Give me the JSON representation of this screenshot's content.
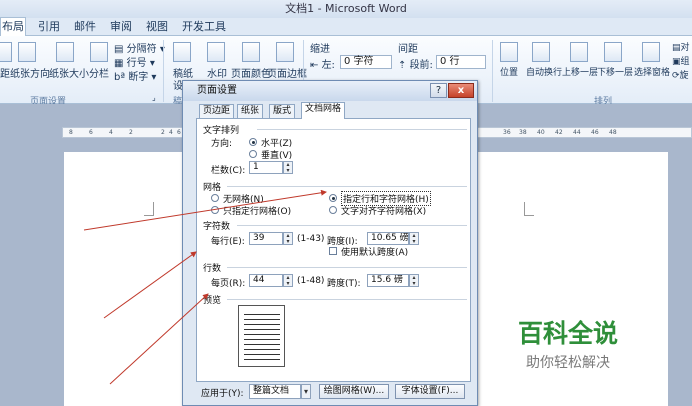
{
  "window": {
    "title": "文档1 - Microsoft Word"
  },
  "tabs": {
    "active": "布局",
    "items": [
      "引用",
      "邮件",
      "审阅",
      "视图",
      "开发工具"
    ]
  },
  "ribbon": {
    "page_setup": {
      "margins": "距",
      "orientation": "纸张方向",
      "size": "纸张大小",
      "columns": "分栏",
      "breaks": "分隔符",
      "line_numbers": "行号",
      "hyphenation": "断字",
      "group": "页面设置"
    },
    "manuscript": {
      "label1": "稿纸",
      "label2": "设",
      "group": "稿"
    },
    "background": {
      "watermark": "水印",
      "page_color": "页面颜色",
      "page_borders": "页面边框"
    },
    "paragraph": {
      "indent_label": "缩进",
      "left_label": "左:",
      "left_value": "0 字符",
      "spacing_label": "间距",
      "before_label": "段前:",
      "before_value": "0 行"
    },
    "arrange": {
      "position": "位置",
      "wrap": "自动换行",
      "forward": "上移一层",
      "backward": "下移一层",
      "selection": "选择窗格",
      "align": "对",
      "group_label": "组",
      "rotate": "旋",
      "group": "排列"
    }
  },
  "ruler": {
    "left_ticks": [
      "8",
      "6",
      "4",
      "2",
      "2",
      "4",
      "6",
      "8"
    ],
    "right_ticks": [
      "36",
      "38",
      "40",
      "42",
      "44",
      "46",
      "48"
    ]
  },
  "dialog": {
    "title": "页面设置",
    "help": "?",
    "close": "x",
    "tabs": [
      "页边距",
      "纸张",
      "版式",
      "文档网格"
    ],
    "text_direction": {
      "section": "文字排列",
      "direction_label": "方向:",
      "horizontal": "水平(Z)",
      "vertical": "垂直(V)",
      "columns_label": "栏数(C):",
      "columns_value": "1"
    },
    "grid": {
      "section": "网格",
      "no_grid": "无网格(N)",
      "lines_only": "只指定行网格(O)",
      "lines_and_chars": "指定行和字符网格(H)",
      "text_snap": "文字对齐字符网格(X)"
    },
    "characters": {
      "section": "字符数",
      "per_line_label": "每行(E):",
      "per_line_value": "39",
      "per_line_range": "(1-43)",
      "pitch_label": "跨度(I):",
      "pitch_value": "10.65 磅",
      "default_pitch": "使用默认跨度(A)"
    },
    "lines": {
      "section": "行数",
      "per_page_label": "每页(R):",
      "per_page_value": "44",
      "per_page_range": "(1-48)",
      "pitch_label": "跨度(T):",
      "pitch_value": "15.6 磅"
    },
    "preview": {
      "section": "预览"
    },
    "footer": {
      "apply_label": "应用于(Y):",
      "apply_value": "整篇文档",
      "draw_grid": "绘图网格(W)...",
      "font_settings": "字体设置(F)..."
    }
  },
  "watermark": {
    "title": "百科全说",
    "subtitle": "助你轻松解决"
  },
  "colors": {
    "ribbon_text": "#1e395b",
    "arrow": "#c0392b",
    "watermark_green": "#2f8f3a",
    "workspace": "#a9b7cc"
  }
}
